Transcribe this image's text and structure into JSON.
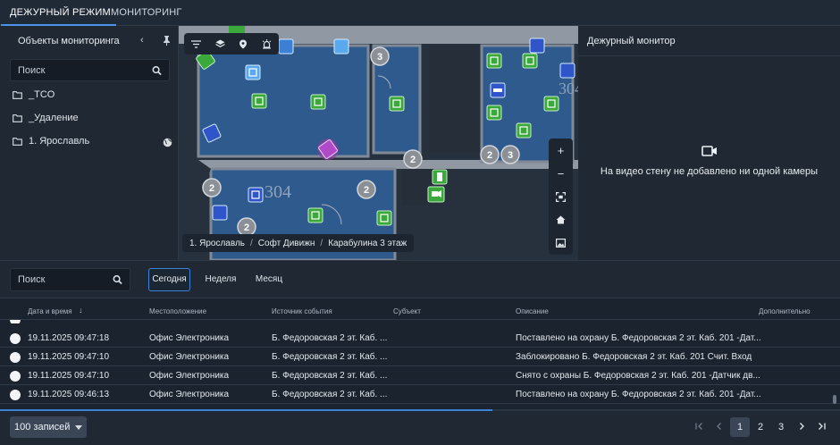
{
  "top_tabs": [
    {
      "label": "ДЕЖУРНЫЙ РЕЖИМ"
    },
    {
      "label": "МОНИТОРИНГ"
    }
  ],
  "left_panel": {
    "title": "Объекты мониторинга",
    "search_placeholder": "Поиск",
    "tree": [
      {
        "label": "_TCO"
      },
      {
        "label": "_Удаление"
      },
      {
        "label": "1. Ярославль"
      }
    ]
  },
  "map": {
    "room_labels": [
      "304",
      "304"
    ],
    "cluster_counts": [
      "3",
      "2",
      "2",
      "2",
      "2",
      "2",
      "2"
    ],
    "breadcrumb": [
      "1. Ярославль",
      "Софт Дивижн",
      "Карабулина 3 этаж"
    ],
    "zoom_in": "+",
    "zoom_out": "−"
  },
  "right_panel": {
    "title": "Дежурный монитор",
    "empty_message": "На видео стену не добавлено ни одной камеры"
  },
  "filters": {
    "search_placeholder": "Поиск",
    "periods": [
      {
        "label": "Сегодня",
        "active": true
      },
      {
        "label": "Неделя",
        "active": false
      },
      {
        "label": "Месяц",
        "active": false
      }
    ]
  },
  "table": {
    "columns": [
      "Дата и время",
      "Местоположение",
      "Источник события",
      "Субъект",
      "Описание",
      "Дополнительно"
    ],
    "sort_indicator": "↓",
    "rows": [
      {
        "datetime": "19.11.2025 09:47:18",
        "location": "Офис Электроника",
        "source": "Б. Федоровская 2 эт. Каб. ...",
        "subject": "",
        "description": "Поставлено на охрану Б. Федоровская 2 эт. Каб. 201 -Дат...",
        "extra": ""
      },
      {
        "datetime": "19.11.2025 09:47:10",
        "location": "Офис Электроника",
        "source": "Б. Федоровская 2 эт. Каб. ...",
        "subject": "",
        "description": "Заблокировано Б. Федоровская 2 эт. Каб. 201 Счит. Вход",
        "extra": ""
      },
      {
        "datetime": "19.11.2025 09:47:10",
        "location": "Офис Электроника",
        "source": "Б. Федоровская 2 эт. Каб. ...",
        "subject": "",
        "description": "Снято с охраны Б. Федоровская 2 эт. Каб. 201 -Датчик дв...",
        "extra": ""
      },
      {
        "datetime": "19.11.2025 09:46:13",
        "location": "Офис Электроника",
        "source": "Б. Федоровская 2 эт. Каб. ...",
        "subject": "",
        "description": "Поставлено на охрану Б. Федоровская 2 эт. Каб. 201 -Дат...",
        "extra": ""
      }
    ]
  },
  "footer": {
    "per_page": "100 записей",
    "pages": [
      "1",
      "2",
      "3"
    ],
    "current_page": "1"
  },
  "colors": {
    "accent": "#3b82d6",
    "room_fill": "#2f5a8e",
    "sensor_green": "#3aa83a",
    "sensor_blue": "#2f6fd6"
  }
}
